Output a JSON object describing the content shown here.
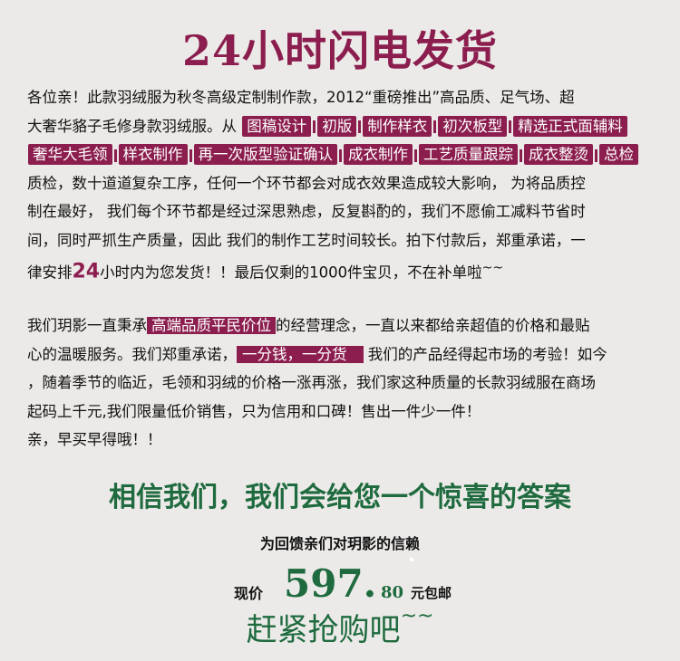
{
  "headline": "24小时闪电发货",
  "intro": {
    "line1": "各位亲！此款羽绒服为秋冬高级定制制作款，2012“重磅推出”高品质、足气场、超",
    "line2_prefix": "大奢华貉子毛修身款羽绒服。从",
    "steps": [
      "图稿设计",
      "初版",
      "制作样衣",
      "初次板型",
      "精选正式面辅料",
      "奢华大毛领",
      "样衣制作",
      "再一次版型验证确认",
      "成衣制作",
      "工艺质量跟踪",
      "成衣整烫",
      "总检"
    ],
    "line4": "质检，数十道道复杂工序，任何一个环节都会对成衣效果造成较大影响，  为将品质控",
    "line5": "制在最好，  我们每个环节都是经过深思熟虑，反复斟酌的，我们不愿偷工减料节省时",
    "line6": "间，同时严抓生产质量，因此 我们的制作工艺时间较长。拍下付款后，郑重承诺，一",
    "line7_prefix": "律安排",
    "line7_highlight": "24",
    "line7_suffix": "小时内为您发货！！最后仅剩的1000件宝贝，不在补单啦",
    "line7_tilde": "~~"
  },
  "brand": {
    "line1_prefix": "我们玥影一直秉承",
    "line1_highlight": "高端品质平民价位",
    "line1_suffix": "的经营理念，一直以来都给亲超值的价格和最贴",
    "line2_prefix": "心的温暖服务。我们郑重承诺，",
    "line2_highlight": "一分钱，一分货",
    "line2_suffix": "  我们的产品经得起市场的考验！如今",
    "line3": "，随着季节的临近，毛领和羽绒的价格一涨再涨，我们家这种质量的长款羽绒服在商场",
    "line4": "起码上千元,我们限量低价销售，只为信用和口碑！售出一件少一件！",
    "line5": "亲，早买早得哦！！"
  },
  "slogan": "相信我们，我们会给您一个惊喜的答案",
  "thanks": "为回馈亲们对玥影的信赖",
  "price": {
    "label": "现价",
    "main": "597.",
    "cents": "80",
    "note": "元包邮"
  },
  "cta": "赶紧抢购吧",
  "cta_tilde": "~~",
  "colors": {
    "accent": "#8b1e4e",
    "green": "#1f6b3f",
    "background": "#eceae8"
  }
}
